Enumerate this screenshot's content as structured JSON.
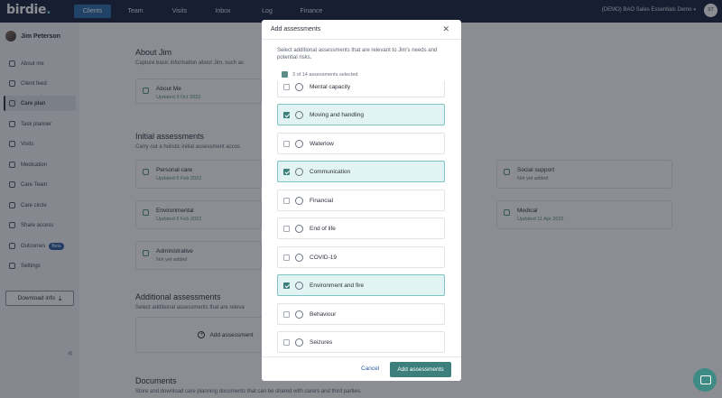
{
  "app": {
    "logo_text": "birdie",
    "logo_dot": "."
  },
  "nav": {
    "items": [
      {
        "label": "Clients",
        "active": true
      },
      {
        "label": "Team"
      },
      {
        "label": "Visits"
      },
      {
        "label": "Inbox"
      },
      {
        "label": "Log"
      },
      {
        "label": "Finance"
      }
    ],
    "account_label": "(DEMO) BAO Sales Essentials Demo",
    "account_caret": "▾",
    "avatar_initials": "ST"
  },
  "sidebar": {
    "user_name": "Jim Peterson",
    "items": [
      {
        "label": "About me"
      },
      {
        "label": "Client feed"
      },
      {
        "label": "Care plan",
        "active": true
      },
      {
        "label": "Task planner"
      },
      {
        "label": "Visits"
      },
      {
        "label": "Medication"
      },
      {
        "label": "Care Team"
      },
      {
        "label": "Care circle"
      },
      {
        "label": "Share access"
      },
      {
        "label": "Outcomes",
        "badge": "Beta"
      },
      {
        "label": "Settings"
      }
    ],
    "download_label": "Download info",
    "collapse_glyph": "«"
  },
  "main": {
    "about_title": "About Jim",
    "about_sub": "Capture basic information about Jim, such as",
    "about_card": {
      "title": "About Me",
      "meta": "Updated 3 Oct 2022"
    },
    "initial_title": "Initial assessments",
    "initial_sub": "Carry out a holistic initial assessment accos",
    "initial_cards": [
      {
        "title": "Personal care",
        "meta": "Updated 6 Feb 2022"
      },
      {
        "title": "Environmental",
        "meta": "Updated 6 Feb 2022"
      },
      {
        "title": "Administrative",
        "meta": "Not yet added"
      },
      {
        "title": "Social support",
        "meta": "Not yet added"
      },
      {
        "title": "Medical",
        "meta": "Updated 11 Apr 2022"
      }
    ],
    "additional_title": "Additional assessments",
    "additional_sub": "Select additional assessments that are releva",
    "add_assessment_label": "Add assessment",
    "documents_title": "Documents",
    "documents_sub": "Store and download care planning documents that can be shared with carers and third parties."
  },
  "modal": {
    "title": "Add assessments",
    "close_glyph": "✕",
    "description": "Select additional assessments that are relevant to Jim's needs and potential risks.",
    "selected_count": "3 of 14 assessments selected",
    "items": [
      {
        "label": "Mental capacity",
        "checked": false,
        "icon": "head-icon"
      },
      {
        "label": "Moving and handling",
        "checked": true,
        "icon": "person-walking-icon"
      },
      {
        "label": "Waterlow",
        "checked": false,
        "icon": "bed-icon"
      },
      {
        "label": "Communication",
        "checked": true,
        "icon": "speech-icon"
      },
      {
        "label": "Financial",
        "checked": false,
        "icon": "wallet-icon"
      },
      {
        "label": "End of life",
        "checked": false,
        "icon": "heart-hands-icon"
      },
      {
        "label": "COVID-19",
        "checked": false,
        "icon": "virus-icon"
      },
      {
        "label": "Environment and fire",
        "checked": true,
        "icon": "fire-icon"
      },
      {
        "label": "Behaviour",
        "checked": false,
        "icon": "face-icon"
      },
      {
        "label": "Seizures",
        "checked": false,
        "icon": "brain-icon"
      }
    ],
    "cancel_label": "Cancel",
    "submit_label": "Add assessments"
  },
  "colors": {
    "accent": "#3d7f7c",
    "nav_bg": "#17203a",
    "selected_row": "#e1f3f3"
  }
}
